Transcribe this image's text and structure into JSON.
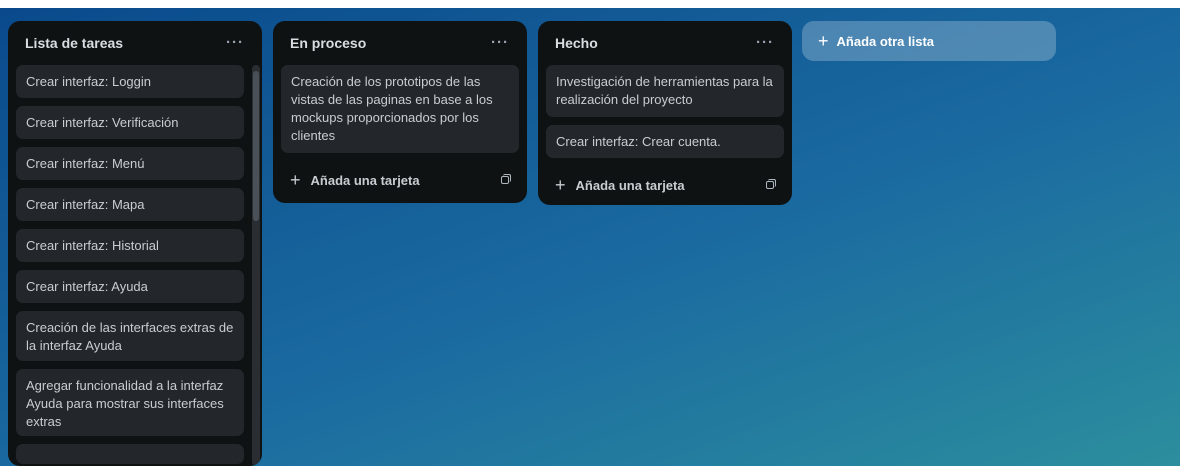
{
  "lists": [
    {
      "title": "Lista de tareas",
      "cards": [
        "Crear interfaz: Loggin",
        "Crear interfaz: Verificación",
        "Crear interfaz: Menú",
        "Crear interfaz: Mapa",
        "Crear interfaz: Historial",
        "Crear interfaz: Ayuda",
        "Creación de las interfaces extras de la interfaz Ayuda",
        "Agregar funcionalidad a la interfaz Ayuda para mostrar sus interfaces extras"
      ]
    },
    {
      "title": "En proceso",
      "cards": [
        "Creación de los prototipos de las vistas de las paginas en base a los mockups proporcionados por los clientes"
      ],
      "add_card_label": "Añada una tarjeta"
    },
    {
      "title": "Hecho",
      "cards": [
        "Investigación de herramientas para la realización del proyecto",
        "Crear interfaz: Crear cuenta."
      ],
      "add_card_label": "Añada una tarjeta"
    }
  ],
  "list_menu_glyph": "···",
  "add_list_label": "Añada otra lista",
  "colors": {
    "board_gradient_start": "#0a4a8c",
    "board_gradient_end": "#2c8e9e",
    "list_bg": "#0f1212",
    "card_bg": "#23272c",
    "card_text": "#c8cdd2"
  }
}
